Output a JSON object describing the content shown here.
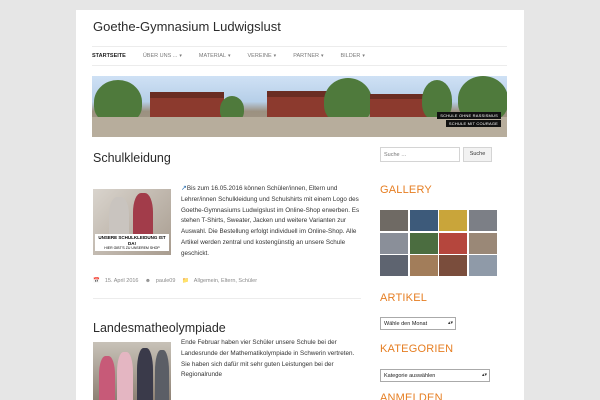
{
  "site": {
    "title": "Goethe-Gymnasium Ludwigslust"
  },
  "nav": {
    "items": [
      {
        "label": "Startseite",
        "dropdown": false,
        "active": true
      },
      {
        "label": "Über uns ...",
        "dropdown": true
      },
      {
        "label": "Material",
        "dropdown": true
      },
      {
        "label": "Vereine",
        "dropdown": true
      },
      {
        "label": "Partner",
        "dropdown": true
      },
      {
        "label": "Bilder",
        "dropdown": true
      }
    ]
  },
  "header": {
    "badge_1": "SCHULE OHNE RASSISMUS",
    "badge_2": "SCHULE MIT COURAGE"
  },
  "posts": [
    {
      "title": "Schulkleidung",
      "thumb_text": "UNSERE SCHULKLEIDUNG IST DA!",
      "thumb_subtext": "HIER GIBT'S ZU UNSEREM SHOP",
      "body": "Bis zum 16.05.2016 können Schüler/innen, Eltern und Lehrer/innen Schulkleidung und Schulshirts mit einem Logo des Goethe-Gymnasiums Ludwigslust im Online-Shop erwerben. Es stehen T-Shirts, Sweater, Jacken und weitere Varianten zur Auswahl. Die Bestellung erfolgt individuell im Online-Shop. Alle Artikel werden zentral und kostengünstig an unsere Schule geschickt.",
      "date": "15. April 2016",
      "author": "paule09",
      "categories": "Allgemein, Eltern, Schüler"
    },
    {
      "title": "Landesmatheolympiade",
      "body": "Ende Februar haben vier Schüler unsere Schule bei der Landesrunde der Mathematikolympiade in Schwerin vertreten. Sie haben sich dafür mit sehr guten Leistungen bei der Regionalrunde"
    }
  ],
  "sidebar": {
    "search_placeholder": "Suche …",
    "search_button": "Suche",
    "gallery_title": "Gallery",
    "archive_title": "Artikel",
    "archive_select": "Wähle den Monat",
    "categories_title": "Kategorien",
    "categories_select": "Kategorie auswählen",
    "login_title": "Anmelden"
  },
  "icons": {
    "link": "external-link-icon",
    "date": "calendar-icon",
    "author": "user-icon",
    "category": "folder-icon"
  },
  "colors": {
    "accent": "#e67e22",
    "link": "#2a6fb0"
  }
}
